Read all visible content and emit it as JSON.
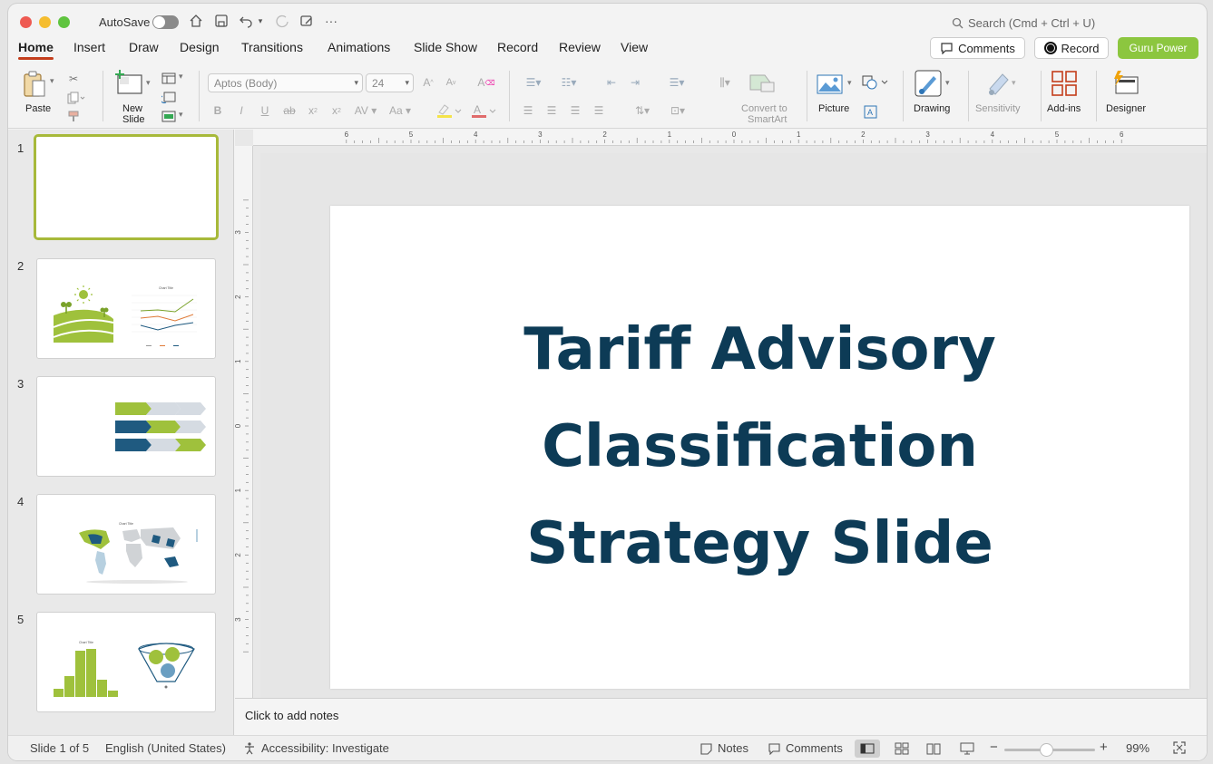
{
  "titlebar": {
    "autosave_label": "AutoSave",
    "search_placeholder": "Search (Cmd + Ctrl + U)"
  },
  "tabs": [
    {
      "label": "Home",
      "active": true
    },
    {
      "label": "Insert"
    },
    {
      "label": "Draw"
    },
    {
      "label": "Design"
    },
    {
      "label": "Transitions"
    },
    {
      "label": "Animations"
    },
    {
      "label": "Slide Show"
    },
    {
      "label": "Record"
    },
    {
      "label": "Review"
    },
    {
      "label": "View"
    }
  ],
  "header_buttons": {
    "comments": "Comments",
    "record": "Record",
    "guru": "Guru Power"
  },
  "ribbon": {
    "paste": "Paste",
    "new_slide_1": "New",
    "new_slide_2": "Slide",
    "font_name": "Aptos (Body)",
    "font_size": "24",
    "convert_1": "Convert to",
    "convert_2": "SmartArt",
    "picture": "Picture",
    "drawing": "Drawing",
    "sensitivity": "Sensitivity",
    "addins": "Add-ins",
    "designer": "Designer"
  },
  "ruler": {
    "h_labels": [
      "6",
      "5",
      "4",
      "3",
      "2",
      "1",
      "0",
      "1",
      "2",
      "3",
      "4",
      "5",
      "6"
    ],
    "v_labels": [
      "3",
      "2",
      "1",
      "0",
      "1",
      "2",
      "3"
    ]
  },
  "slides": [
    {
      "number": "1"
    },
    {
      "number": "2",
      "chart_title": "Chart Title"
    },
    {
      "number": "3"
    },
    {
      "number": "4",
      "chart_title": "Chart Title"
    },
    {
      "number": "5",
      "chart_title": "Chart Title"
    }
  ],
  "slide": {
    "title_line1": "Tariff Advisory",
    "title_line2": "Classification",
    "title_line3": "Strategy Slide",
    "title_color": "#0d3b56"
  },
  "notes_placeholder": "Click to add notes",
  "status": {
    "slide_count": "Slide 1 of 5",
    "language": "English (United States)",
    "accessibility": "Accessibility: Investigate",
    "notes": "Notes",
    "comments": "Comments",
    "zoom": "99%"
  },
  "colors": {
    "accent_green": "#8cc63f",
    "home_underline": "#c43e1c",
    "navy": "#1f5a80"
  }
}
